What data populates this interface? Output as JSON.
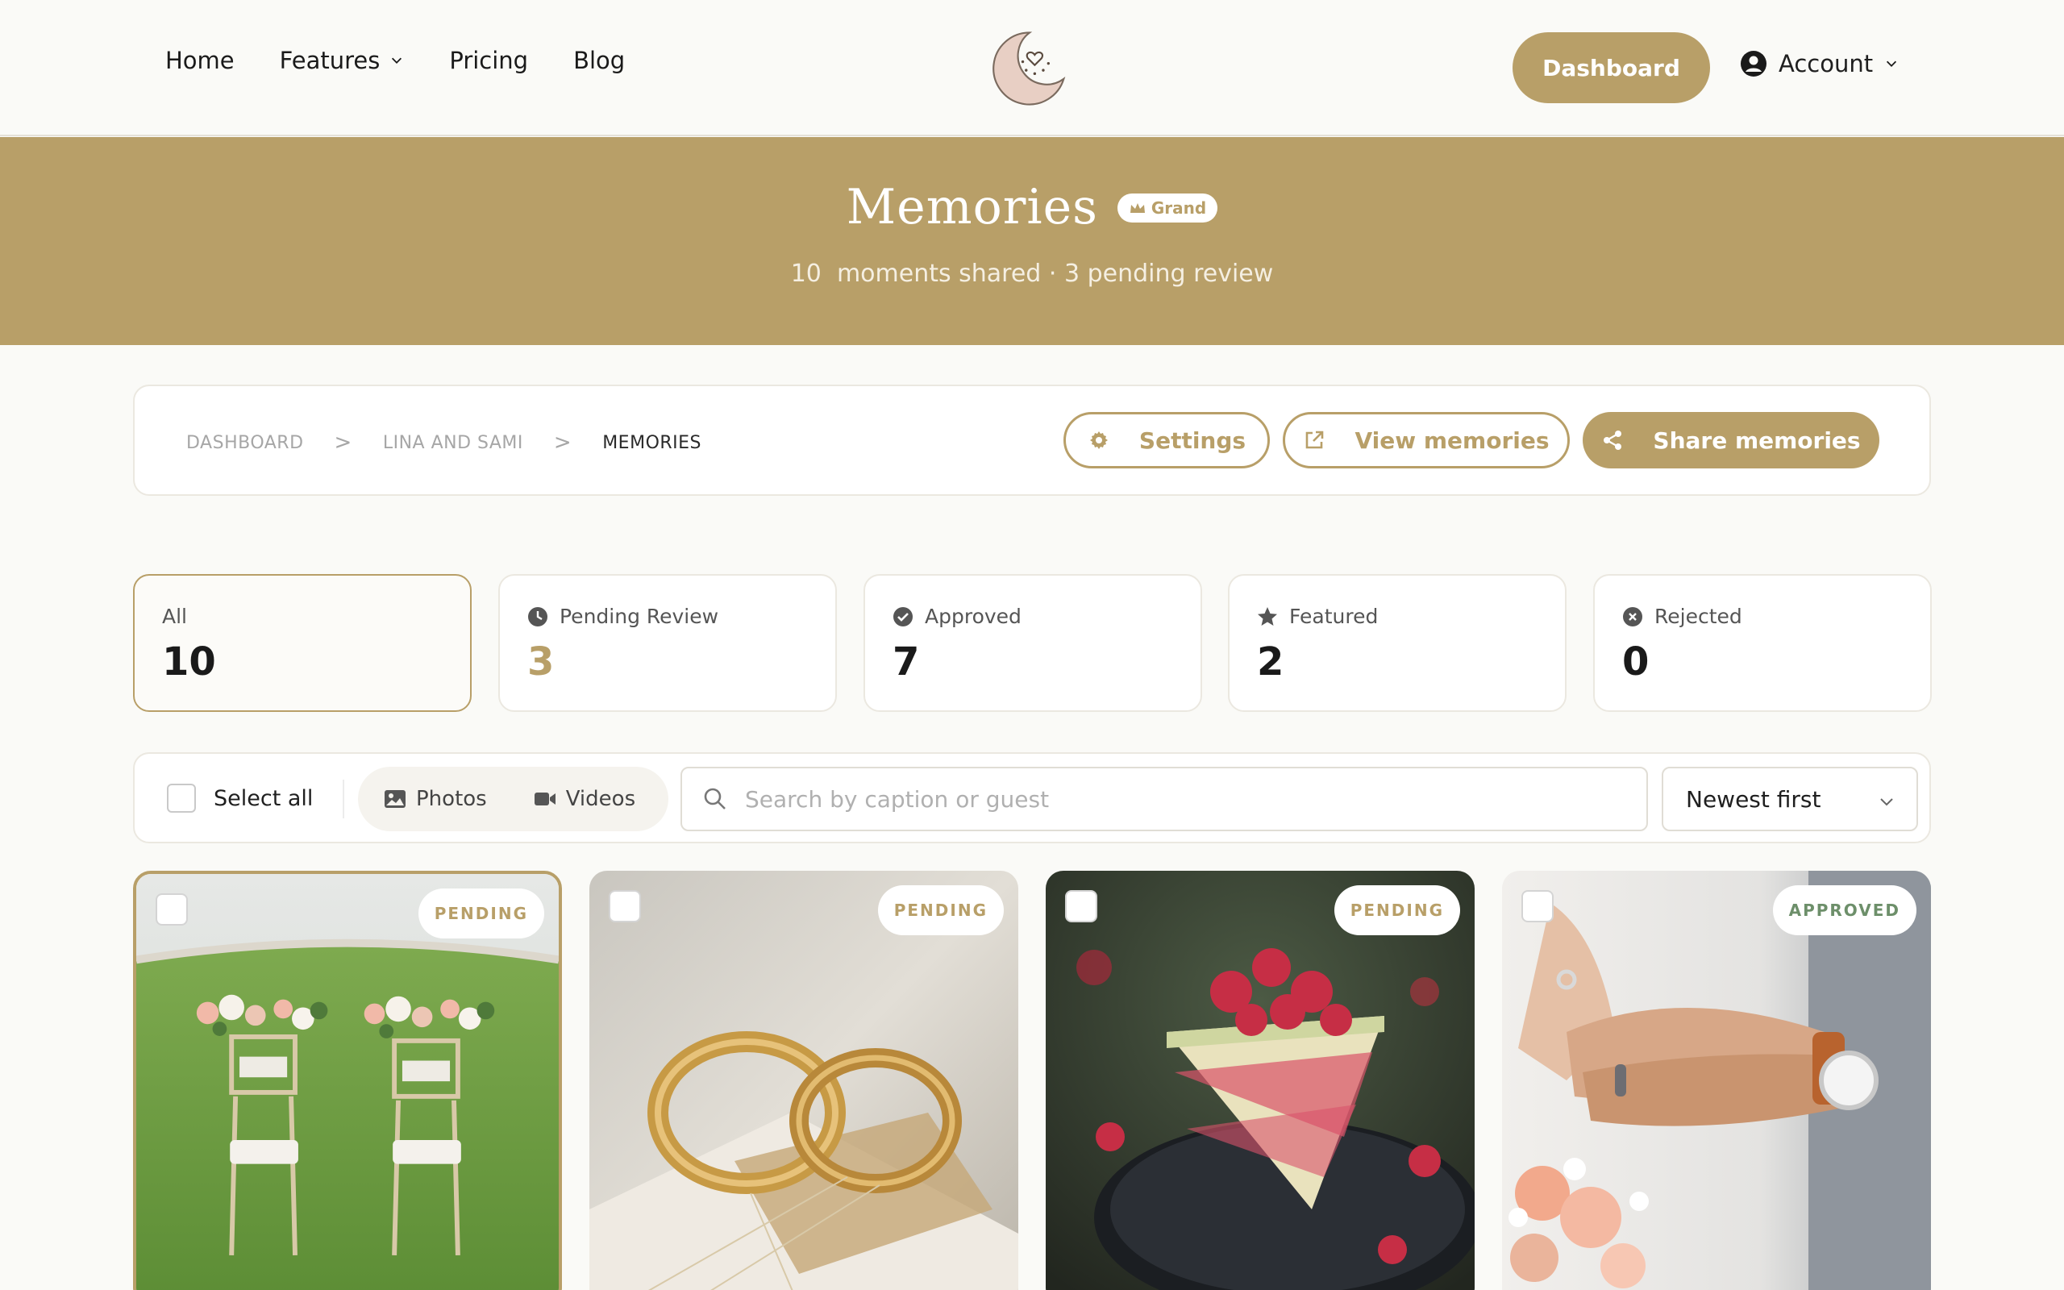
{
  "nav": {
    "links": [
      "Home",
      "Features",
      "Pricing",
      "Blog"
    ],
    "dashboard_label": "Dashboard",
    "account_label": "Account"
  },
  "hero": {
    "title": "Memories",
    "tier_badge": "Grand",
    "subtitle": "10  moments shared · 3 pending review"
  },
  "breadcrumb": {
    "items": [
      "DASHBOARD",
      "LINA AND SAMI",
      "MEMORIES"
    ],
    "separator": ">"
  },
  "actions": {
    "settings": "Settings",
    "view": "View memories",
    "share": "Share memories"
  },
  "stats": [
    {
      "label": "All",
      "value": "10"
    },
    {
      "label": "Pending Review",
      "value": "3"
    },
    {
      "label": "Approved",
      "value": "7"
    },
    {
      "label": "Featured",
      "value": "2"
    },
    {
      "label": "Rejected",
      "value": "0"
    }
  ],
  "toolbar": {
    "select_all": "Select all",
    "filter_photos": "Photos",
    "filter_videos": "Videos",
    "search_placeholder": "Search by caption or guest",
    "sort_value": "Newest first"
  },
  "gallery": [
    {
      "status": "PENDING",
      "icon": "chairs-photo"
    },
    {
      "status": "PENDING",
      "icon": "rings-photo"
    },
    {
      "status": "PENDING",
      "icon": "cake-photo"
    },
    {
      "status": "APPROVED",
      "icon": "hands-photo"
    }
  ],
  "colors": {
    "accent": "#b89f68",
    "background": "#fafaf7",
    "approved": "#6d8f6a"
  }
}
